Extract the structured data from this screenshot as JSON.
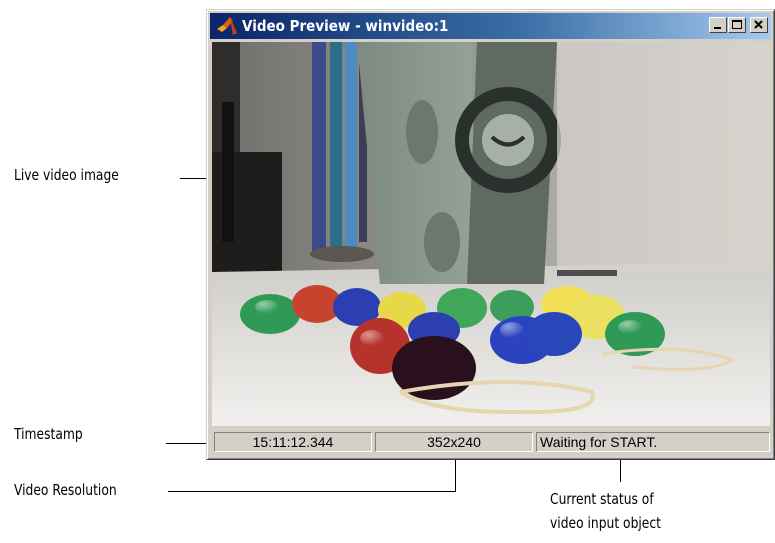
{
  "window": {
    "title": "Video Preview - winvideo:1",
    "icons": {
      "app": "matlab-icon",
      "minimize": "minimize-icon",
      "maximize": "maximize-icon",
      "close": "close-icon"
    },
    "colors": {
      "titlebar_start": "#0a246a",
      "titlebar_end": "#a6caf0",
      "chrome": "#d4d0c8"
    }
  },
  "status_bar": {
    "timestamp": "15:11:12.344",
    "resolution": "352x240",
    "status": "Waiting for START."
  },
  "callouts": {
    "live_video": "Live video image",
    "timestamp": "Timestamp",
    "resolution": "Video Resolution",
    "status_line1": "Current status of",
    "status_line2": "video input object"
  }
}
